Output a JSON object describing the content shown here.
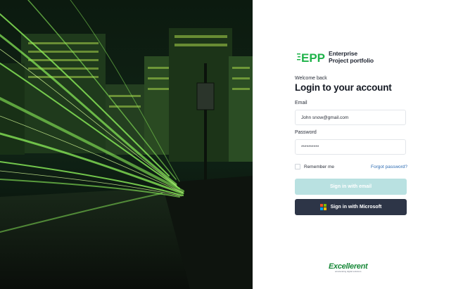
{
  "brand": {
    "logo_mark": "EPP",
    "logo_line1": "Enterprise",
    "logo_line2": "Project portfolio",
    "accent_color": "#1fb34a"
  },
  "login": {
    "welcome": "Welcome back",
    "title": "Login to your account",
    "email_label": "Email",
    "email_value": "John snow@gmail.com",
    "password_label": "Password",
    "password_value": "**********",
    "remember_label": "Remember me",
    "forgot_label": "Forgot password?",
    "email_button": "Sign in with email",
    "microsoft_button": "Sign in with Microsoft"
  },
  "footer": {
    "company": "Excellerent",
    "tagline": "accelerating digital solutions"
  }
}
